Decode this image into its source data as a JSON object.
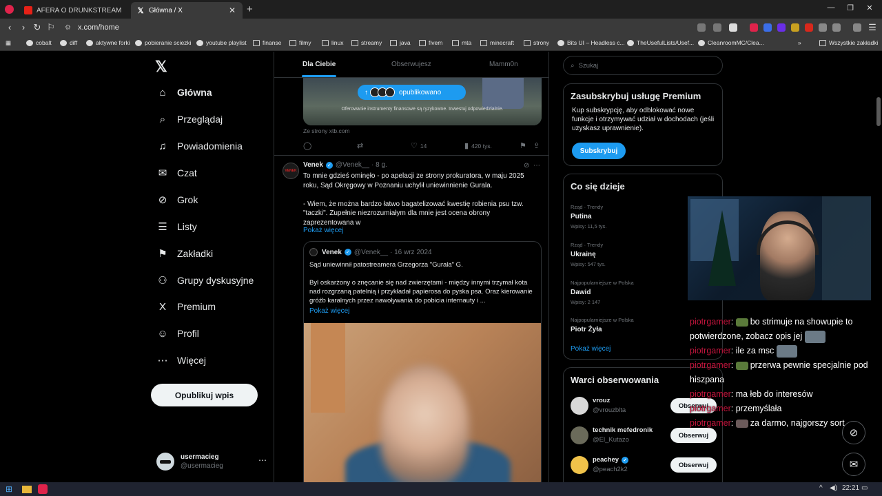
{
  "browser": {
    "tabs": [
      {
        "title": "AFERA O DRUNKSTREAM BRUCEI? Na",
        "icon": "youtube-icon"
      },
      {
        "title": "Główna / X",
        "icon": "x-logo-icon"
      }
    ],
    "new_tab": "+",
    "address": "x.com/home",
    "bookmarks": [
      "cobalt",
      "diff",
      "aktywne forki",
      "pobieranie sciezki",
      "youtube playlist",
      "finanse",
      "filmy",
      "linux",
      "streamy",
      "java",
      "fivem",
      "mta",
      "minecraft",
      "strony",
      "Bits UI – Headless c...",
      "TheUsefulLists/Usef...",
      "CleanroomMC/Clea..."
    ],
    "bookmarks_overflow": "»",
    "all_bookmarks": "Wszystkie zakładki"
  },
  "nav": {
    "items": [
      {
        "label": "Główna",
        "icon": "home-icon",
        "glyph": "⌂"
      },
      {
        "label": "Przeglądaj",
        "icon": "search-icon",
        "glyph": "⌕"
      },
      {
        "label": "Powiadomienia",
        "icon": "bell-icon",
        "glyph": "♫"
      },
      {
        "label": "Czat",
        "icon": "mail-icon",
        "glyph": "✉"
      },
      {
        "label": "Grok",
        "icon": "grok-icon",
        "glyph": "⊘"
      },
      {
        "label": "Listy",
        "icon": "list-icon",
        "glyph": "☰"
      },
      {
        "label": "Zakładki",
        "icon": "bookmark-icon",
        "glyph": "⚑"
      },
      {
        "label": "Grupy dyskusyjne",
        "icon": "communities-icon",
        "glyph": "⚇"
      },
      {
        "label": "Premium",
        "icon": "x-logo-icon",
        "glyph": "X"
      },
      {
        "label": "Profil",
        "icon": "profile-icon",
        "glyph": "☺"
      },
      {
        "label": "Więcej",
        "icon": "more-circle-icon",
        "glyph": "⋯"
      }
    ],
    "post_button": "Opublikuj wpis",
    "user": {
      "name": "usermacieg",
      "handle": "@usermacieg"
    }
  },
  "feed": {
    "tabs": [
      "Dla Ciebie",
      "Obserwujesz",
      "Mamm0n"
    ],
    "ad": {
      "pill_label": "opublikowano",
      "disclaimer": "Oferowanie instrumenty finansowe są ryzykowne. Inwestuj odpowiedzialnie.",
      "source": "Ze strony xtb.com",
      "likes": "14",
      "views": "420 tys."
    },
    "tweet": {
      "avatar_text": "VENEK",
      "name": "Venek",
      "handle": "@Venek__",
      "time": "· 8 g.",
      "text": "To mnie gdzieś ominęło - po apelacji ze strony prokuratora, w maju 2025 roku, Sąd Okręgowy w Poznaniu uchylił uniewinnienie Gurala.\n\n- Wiem, że można bardzo łatwo bagatelizować kwestię robienia psu tzw. \"taczki\". Zupełnie niezrozumiałym dla mnie jest ocena obrony zaprezentowana w",
      "show_more": "Pokaż więcej",
      "quote": {
        "name": "Venek",
        "handle": "@Venek__",
        "time": "· 16 wrz 2024",
        "text": "Sąd uniewinnił patostreamera Grzegorza \"Gurala\" G.\n\nByl oskarżony o znęcanie się nad zwierzętami - między innymi trzymał kota nad rozgrzaną patelnią i przykładał papierosa do pyska psa. Oraz kierowanie gróźb karalnych przez nawoływania do pobicia internauty i ...",
        "show_more": "Pokaż więcej"
      }
    }
  },
  "right": {
    "search_placeholder": "Szukaj",
    "premium": {
      "title": "Zasubskrybuj usługę Premium",
      "desc": "Kup subskrypcję, aby odblokować nowe funkcje i otrzymywać udział w dochodach (jeśli uzyskasz uprawnienie).",
      "button": "Subskrybuj"
    },
    "trends": {
      "title": "Co się dzieje",
      "items": [
        {
          "category": "Rząd · Trendy",
          "name": "Putina",
          "count": "Wpisy: 11,5 tys."
        },
        {
          "category": "Rząd · Trendy",
          "name": "Ukrainę",
          "count": "Wpisy: 547 tys."
        },
        {
          "category": "Najpopularniejsze w Polska",
          "name": "Dawid",
          "count": "Wpisy: 2 147"
        },
        {
          "category": "Najpopularniejsze w Polska",
          "name": "Piotr Żyła",
          "count": ""
        }
      ],
      "show_more": "Pokaż więcej"
    },
    "follow": {
      "title": "Warci obserwowania",
      "items": [
        {
          "name": "vrouz",
          "handle": "@vrouzblta",
          "button": "Obserwuj",
          "color": "#d4d4d4"
        },
        {
          "name": "technik mefedronik",
          "handle": "@El_Kutazo",
          "button": "Obserwuj",
          "color": "#6a6a5a"
        },
        {
          "name": "peachey",
          "handle": "@peach2k2",
          "button": "Obserwuj",
          "color": "#f0c24a"
        }
      ]
    }
  },
  "overlay": {
    "chat": [
      {
        "user": "piotrgamer",
        "text": "bo strimuje na showupie to potwierdzone, zobacz opis jej",
        "pre_emote": true,
        "post_emote": true
      },
      {
        "user": "piotrgamer",
        "text": "ile za msc",
        "pre_emote": false,
        "post_emote": true
      },
      {
        "user": "piotrgamer",
        "text": "przerwa pewnie specjalnie pod hiszpana",
        "pre_emote": true,
        "post_emote": false
      },
      {
        "user": "piotrgamer",
        "text": "ma łeb do interesów",
        "pre_emote": false,
        "post_emote": false
      },
      {
        "user": "piotrgamer",
        "text": "przemyślała",
        "pre_emote": false,
        "post_emote": false
      },
      {
        "user": "piotrgamer",
        "text": "za darmo, najgorszy sort",
        "pre_emote": true,
        "post_emote": false
      }
    ]
  },
  "taskbar": {
    "time": "22:21"
  },
  "colors": {
    "accent": "#1d9bf0",
    "chat_user": "#c4153d",
    "background": "#000000"
  }
}
